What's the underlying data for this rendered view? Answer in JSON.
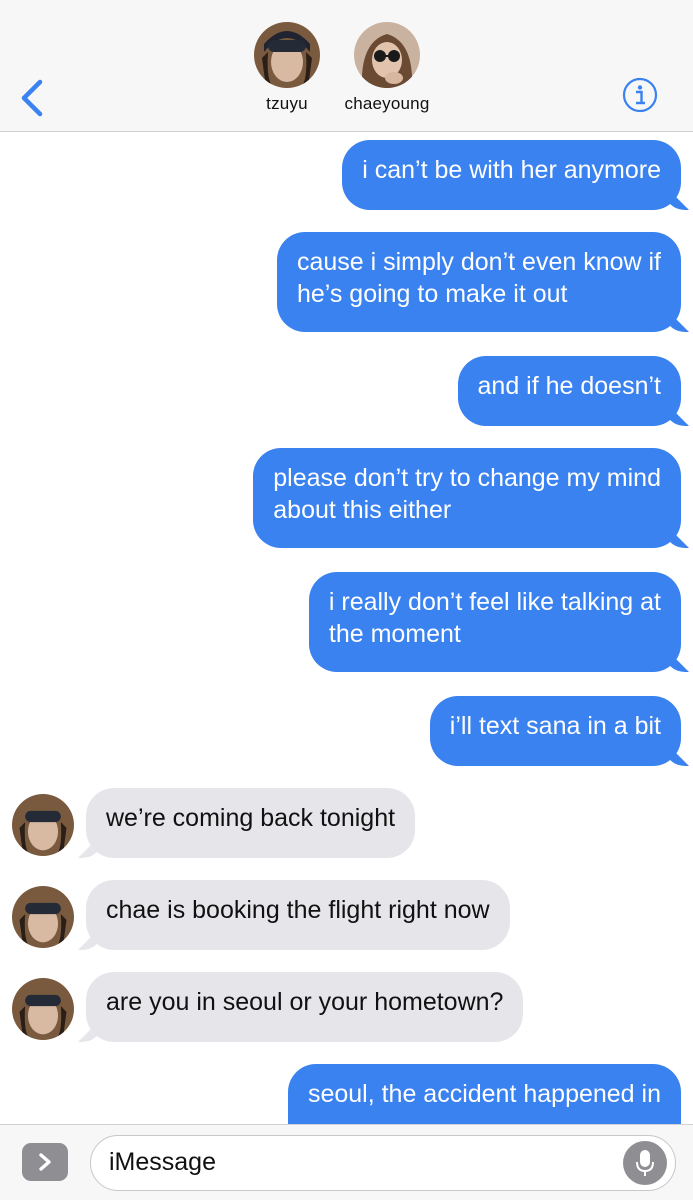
{
  "header": {
    "contacts": [
      {
        "name": "tzuyu"
      },
      {
        "name": "chaeyoung"
      }
    ]
  },
  "messages": [
    {
      "from": "me",
      "text": "i can’t be with her anymore"
    },
    {
      "from": "me",
      "text": "cause i simply don’t even know if\nhe’s going to make it out"
    },
    {
      "from": "me",
      "text": "and if he doesn’t"
    },
    {
      "from": "me",
      "text": "please don’t try to change my mind\nabout this either"
    },
    {
      "from": "me",
      "text": "i really don’t feel like talking at\nthe moment"
    },
    {
      "from": "me",
      "text": "i’ll text sana in a bit"
    },
    {
      "from": "tzuyu",
      "text": "we’re coming back tonight"
    },
    {
      "from": "tzuyu",
      "text": "chae is booking the flight right now"
    },
    {
      "from": "tzuyu",
      "text": "are you in seoul or your hometown?"
    },
    {
      "from": "me",
      "text": "seoul, the accident happened in"
    }
  ],
  "input": {
    "placeholder": "iMessage"
  },
  "colors": {
    "outgoing_bubble": "#3a82f0",
    "incoming_bubble": "#e6e5ea",
    "accent": "#3a82f0"
  },
  "icons": [
    "back-chevron-icon",
    "info-icon",
    "apps-chevron-icon",
    "microphone-icon"
  ]
}
